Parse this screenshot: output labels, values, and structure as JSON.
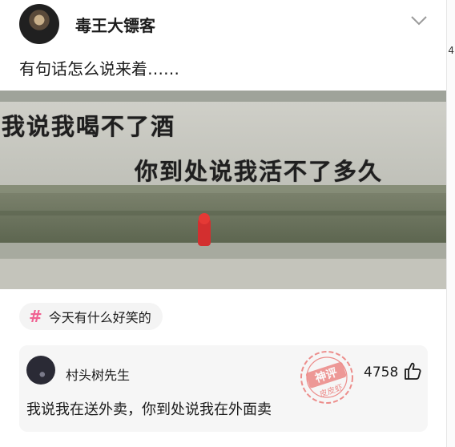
{
  "post": {
    "author": "毒王大镖客",
    "title": "有句话怎么说来着……",
    "image_text": [
      "我说我喝不了酒",
      "你到处说我活不了多久"
    ],
    "topic": "今天有什么好笑的"
  },
  "comment": {
    "user": "村头树先生",
    "likes": "4758",
    "text": "我说我在送外卖，你到处说我在外面卖"
  },
  "watermark": {
    "line1": "神评",
    "line2": "皮皮虾"
  },
  "edge_char": "4",
  "colors": {
    "topic_hash": "#f06292",
    "watermark": "#e53935"
  }
}
